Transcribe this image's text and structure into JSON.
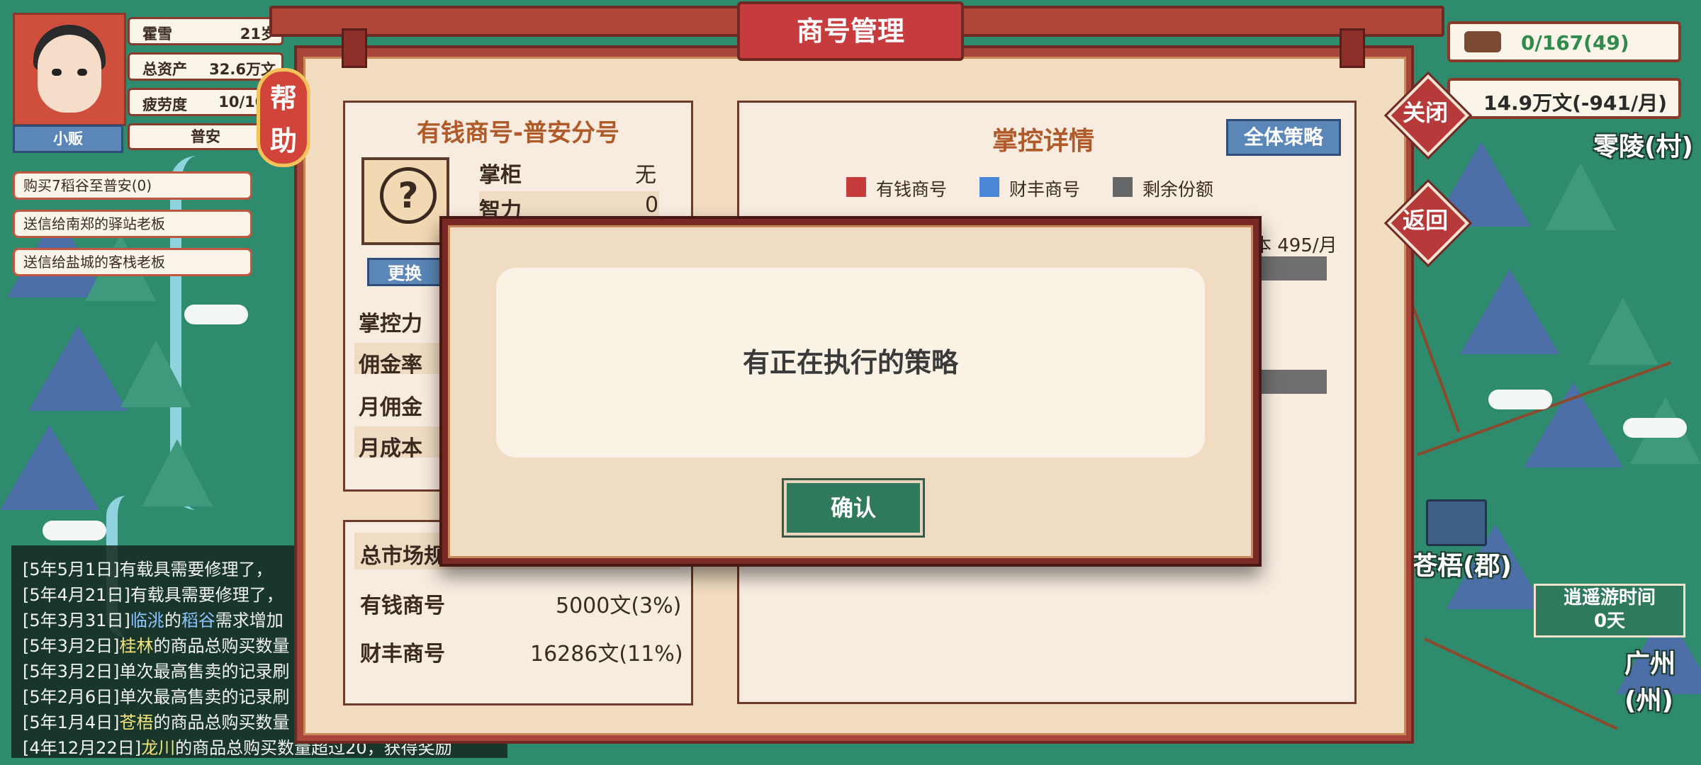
{
  "player": {
    "name": "霍雪",
    "name_value": "21岁",
    "assets_label": "总资产",
    "assets_value": "32.6万文",
    "fatigue_label": "疲劳度",
    "fatigue_value": "10/100",
    "rank": "小贩",
    "location": "普安"
  },
  "tasks": [
    "购买7稻谷至普安(0)",
    "送信给南郑的驿站老板",
    "送信给盐城的客栈老板"
  ],
  "resources": {
    "caravan": "0/167(49)",
    "money": "14.9万文(-941/月)"
  },
  "map": {
    "cities": [
      "零陵(村)",
      "苍梧(郡)",
      "广州(州)"
    ],
    "travel_time_label": "逍遥游时间",
    "travel_time_value": "0天"
  },
  "log": [
    {
      "date": "[5年5月1日]",
      "text": "有载具需要修理了，",
      "place": "",
      "goods": ""
    },
    {
      "date": "[5年4月21日]",
      "text": "有载具需要修理了，",
      "place": "",
      "goods": ""
    },
    {
      "date": "[5年3月31日]",
      "place": "临洮",
      "mid": "的",
      "goods": "稻谷",
      "text": "需求增加"
    },
    {
      "date": "[5年3月2日]",
      "place": "桂林",
      "text": "的商品总购买数量"
    },
    {
      "date": "[5年3月2日]",
      "text": "单次最高售卖的记录刷"
    },
    {
      "date": "[5年2月6日]",
      "text": "单次最高售卖的记录刷"
    },
    {
      "date": "[5年1月4日]",
      "place": "苍梧",
      "text": "的商品总购买数量"
    },
    {
      "date": "[4年12月22日]",
      "place": "龙川",
      "text": "的商品总购买数量超过20，获得奖励"
    }
  ],
  "dialog": {
    "title": "商号管理",
    "help": [
      "帮",
      "助"
    ],
    "close": "关闭",
    "back": "返回",
    "branch": {
      "name": "有钱商号-普安分号",
      "manager_label": "掌柜",
      "manager_value": "无",
      "intellect_label": "智力",
      "intellect_value": "0",
      "replace_button": "更换",
      "rows": [
        "掌控力",
        "佣金率",
        "月佣金",
        "月成本"
      ]
    },
    "market": {
      "title": "总市场规模",
      "rows": [
        {
          "label": "有钱商号",
          "value": "5000文(3%)"
        },
        {
          "label": "财丰商号",
          "value": "16286文(11%)"
        }
      ]
    },
    "control": {
      "title": "掌控详情",
      "all_strategy_button": "全体策略",
      "legend": [
        {
          "label": "有钱商号",
          "color": "#c63b3b"
        },
        {
          "label": "财丰商号",
          "color": "#4a86d6"
        },
        {
          "label": "剩余份额",
          "color": "#666666"
        }
      ],
      "cost_text": "本 495/月"
    }
  },
  "modal": {
    "message": "有正在执行的策略",
    "confirm": "确认"
  }
}
